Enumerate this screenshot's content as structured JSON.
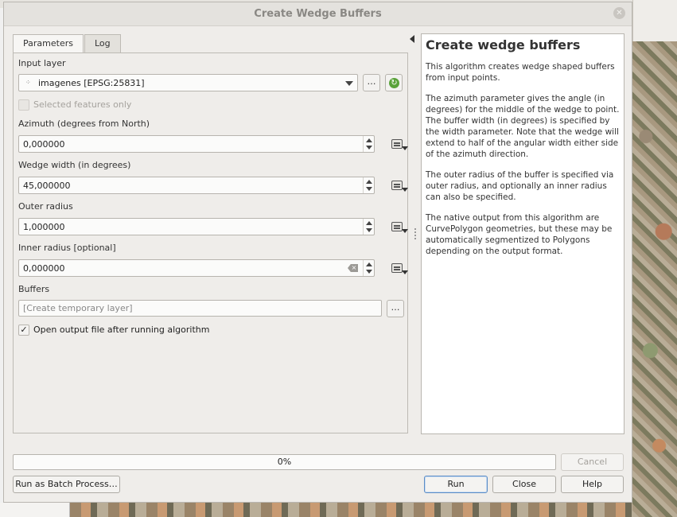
{
  "window": {
    "title": "Create Wedge Buffers"
  },
  "tabs": [
    {
      "label": "Parameters"
    },
    {
      "label": "Log"
    }
  ],
  "parameters": {
    "input_layer": {
      "label": "Input layer",
      "value": "imagenes [EPSG:25831]",
      "browse": "…"
    },
    "selected_only": {
      "label": "Selected features only",
      "checked": false
    },
    "azimuth": {
      "label": "Azimuth (degrees from North)",
      "value": "0,000000"
    },
    "width": {
      "label": "Wedge width (in degrees)",
      "value": "45,000000"
    },
    "outer_radius": {
      "label": "Outer radius",
      "value": "1,000000"
    },
    "inner_radius": {
      "label": "Inner radius [optional]",
      "value": "0,000000"
    },
    "buffers": {
      "label": "Buffers",
      "placeholder": "[Create temporary layer]",
      "browse": "…"
    },
    "open_output": {
      "label": "Open output file after running algorithm",
      "checked": true,
      "mark": "✓"
    }
  },
  "help": {
    "title": "Create wedge buffers",
    "paragraphs": [
      "This algorithm creates wedge shaped buffers from input points.",
      "The azimuth parameter gives the angle (in degrees) for the middle of the wedge to point. The buffer width (in degrees) is specified by the width parameter. Note that the wedge will extend to half of the angular width either side of the azimuth direction.",
      "The outer radius of the buffer is specified via outer radius, and optionally an inner radius can also be specified.",
      "The native output from this algorithm are CurvePolygon geometries, but these may be automatically segmentized to Polygons depending on the output format."
    ]
  },
  "progress": {
    "text": "0%",
    "value": 0
  },
  "buttons": {
    "cancel": "Cancel",
    "batch": "Run as Batch Process…",
    "run": "Run",
    "close": "Close",
    "help": "Help"
  },
  "icons": {
    "close": "close-icon",
    "refresh": "refresh-icon",
    "data_defined": "data-defined-override-icon"
  }
}
